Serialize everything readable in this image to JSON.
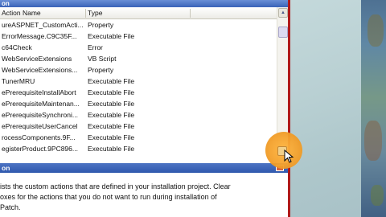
{
  "window": {
    "title": "on"
  },
  "columns": {
    "action_name": "Action Name",
    "type": "Type"
  },
  "rows": [
    {
      "name": "ureASPNET_CustomActi...",
      "type": "Property"
    },
    {
      "name": "ErrorMessage.C9C35F...",
      "type": "Executable File"
    },
    {
      "name": "c64Check",
      "type": "Error"
    },
    {
      "name": "WebServiceExtensions",
      "type": "VB Script"
    },
    {
      "name": "WebServiceExtensions...",
      "type": "Property"
    },
    {
      "name": "TunerMRU",
      "type": "Executable File"
    },
    {
      "name": "ePrerequisiteInstallAbort",
      "type": "Executable File"
    },
    {
      "name": "ePrerequisiteMaintenan...",
      "type": "Executable File"
    },
    {
      "name": "ePrerequisiteSynchroni...",
      "type": "Executable File"
    },
    {
      "name": "ePrerequisiteUserCancel",
      "type": "Executable File"
    },
    {
      "name": "rocessComponents.9F...",
      "type": "Executable File"
    },
    {
      "name": "egisterProduct.9PC896...",
      "type": "Executable File"
    }
  ],
  "panel": {
    "title": "on",
    "description": [
      "ists the custom actions that are defined in your installation project. Clear",
      "oxes for the actions that you do not want to run during installation of",
      "Patch."
    ]
  },
  "colors": {
    "title_blue": "#3a63b8",
    "splitter_red": "#b01a1a",
    "highlight_orange": "#f4a12c"
  }
}
